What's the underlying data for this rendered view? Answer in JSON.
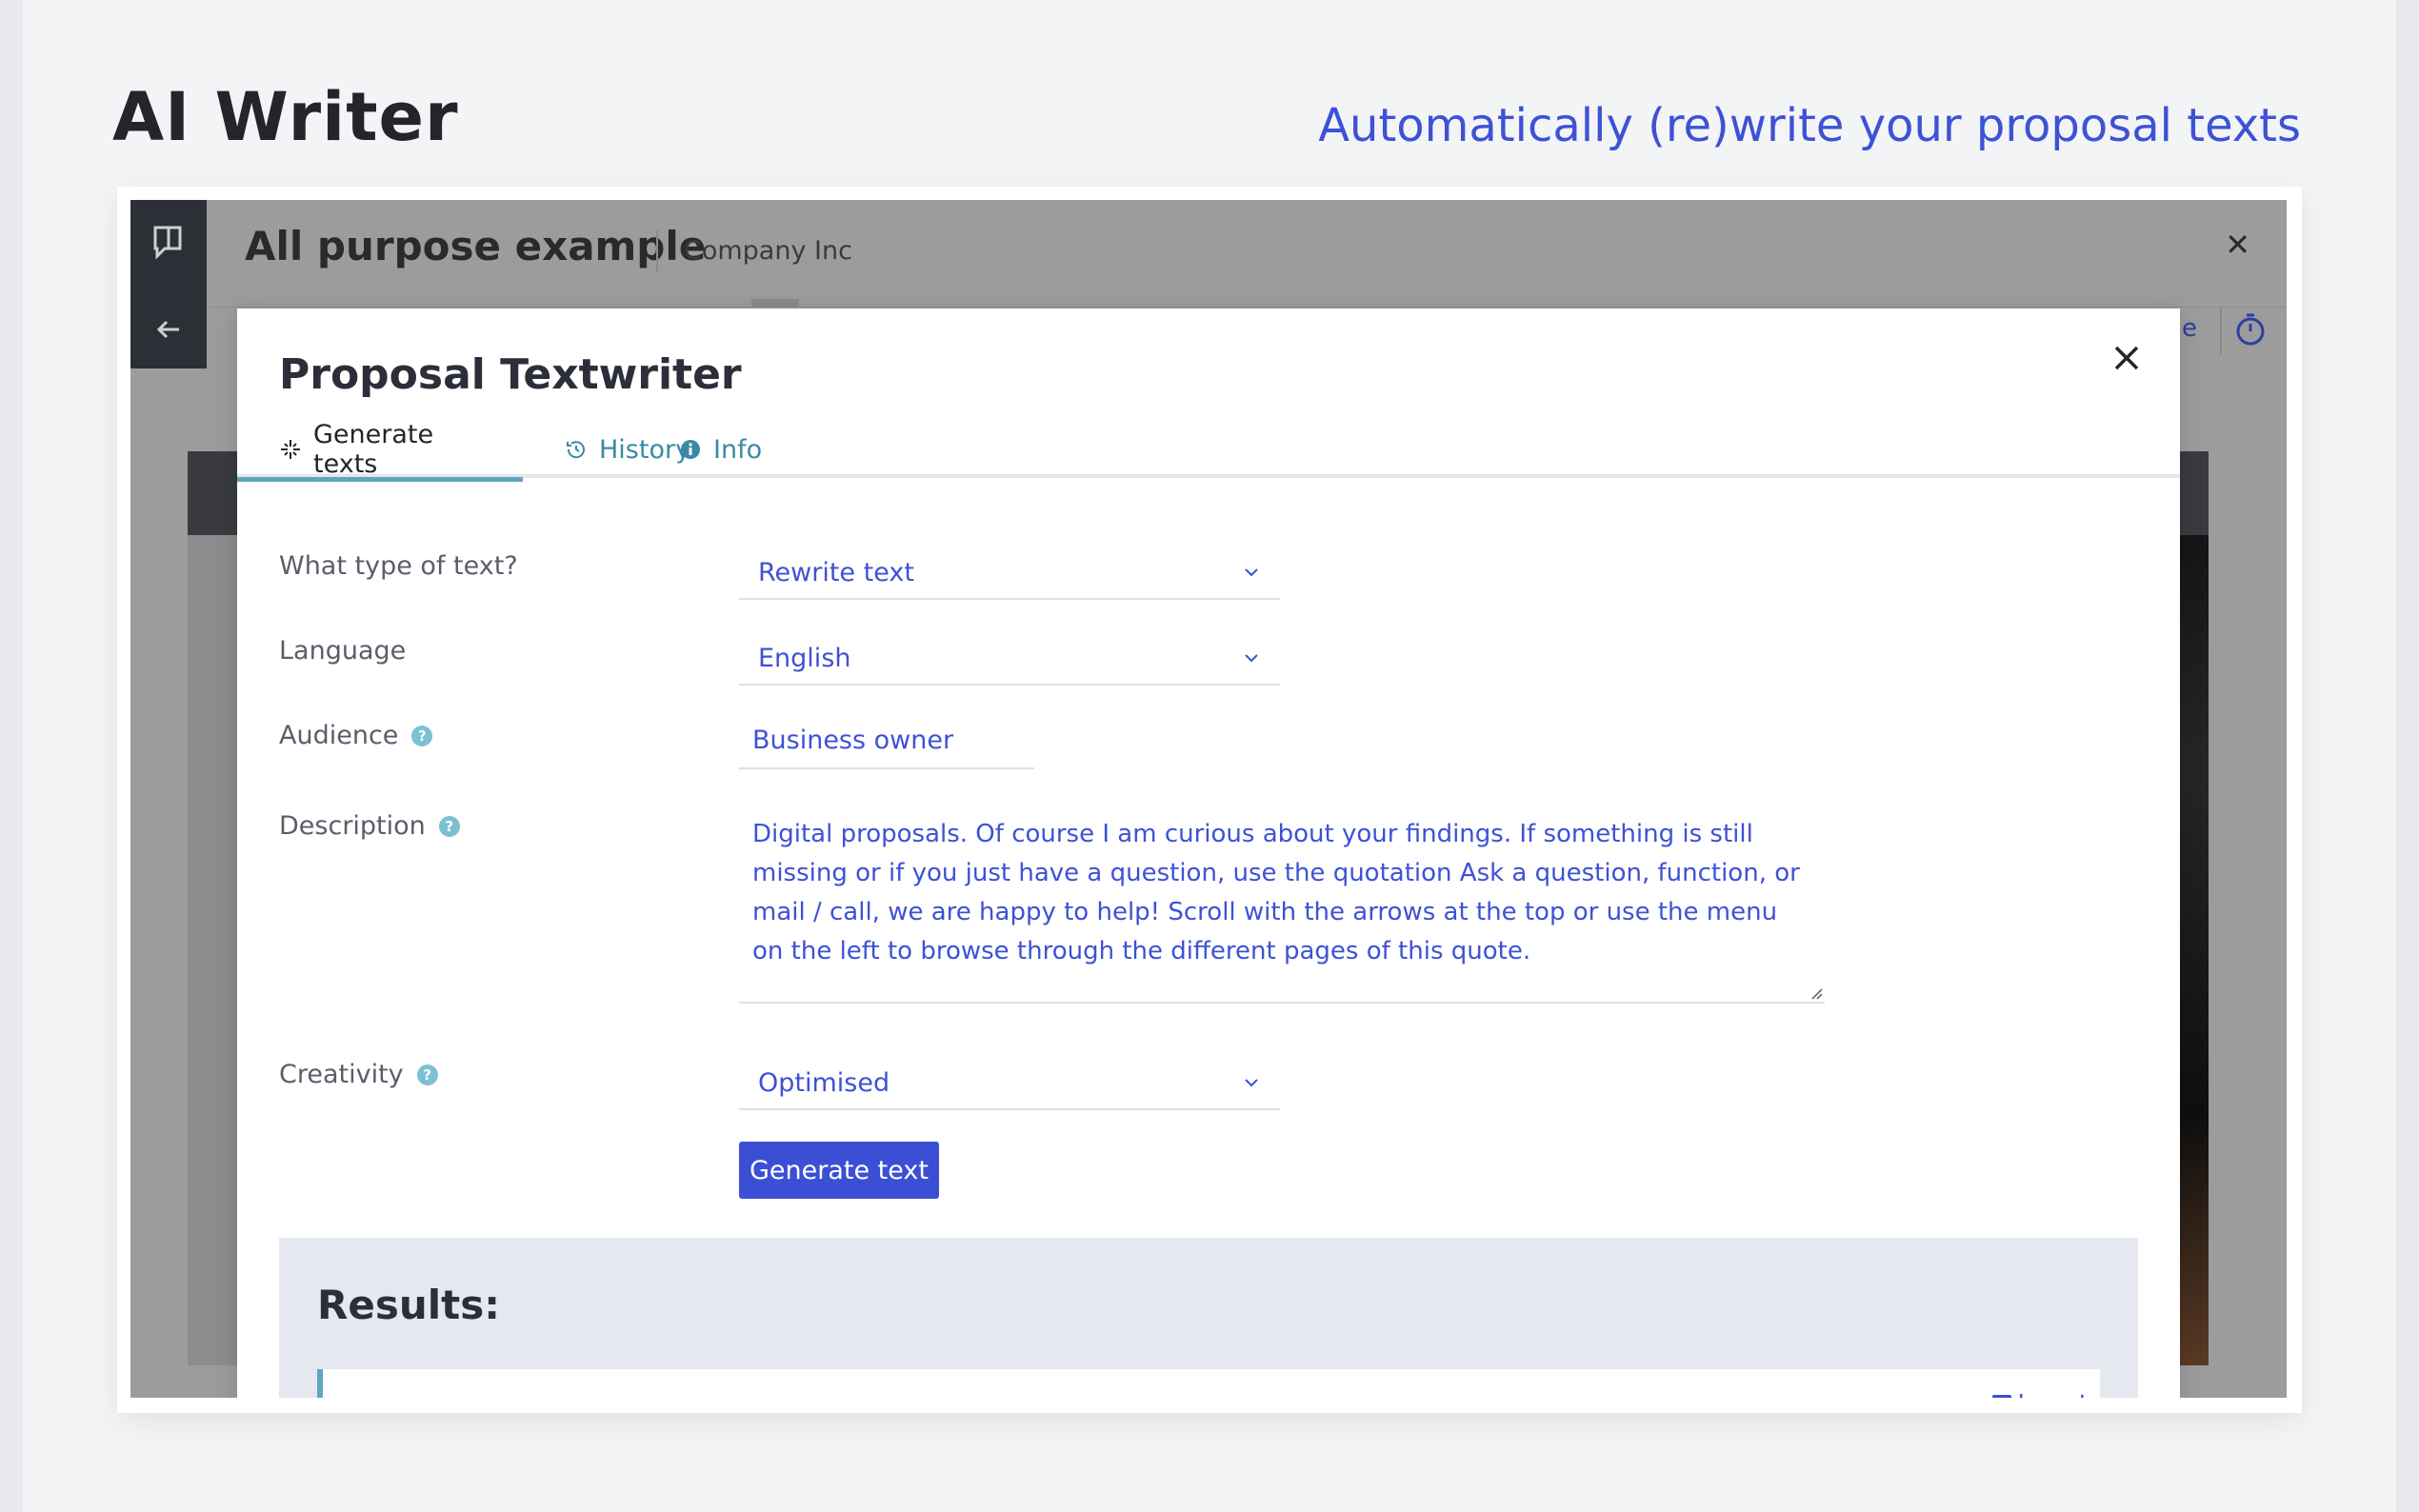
{
  "hero": {
    "title": "AI Writer",
    "subtitle": "Automatically (re)write your proposal texts"
  },
  "app": {
    "title": "All purpose example",
    "company": "Company Inc",
    "close_icon": "close-icon",
    "sidebar_icons": [
      "book-chat-icon",
      "arrow-left-icon"
    ],
    "right_link_partial": "e",
    "timer_icon": "stopwatch-icon"
  },
  "modal": {
    "title": "Proposal Textwriter",
    "close_icon": "close-icon",
    "tabs": [
      {
        "label": "Generate texts",
        "icon": "sparkle-icon",
        "active": true
      },
      {
        "label": "History",
        "icon": "history-icon",
        "active": false
      },
      {
        "label": "Info",
        "icon": "info-icon",
        "active": false
      }
    ],
    "form": {
      "text_type": {
        "label": "What type of text?",
        "value": "Rewrite text"
      },
      "language": {
        "label": "Language",
        "value": "English"
      },
      "audience": {
        "label": "Audience",
        "value": "Business owner",
        "help_icon": "question-icon"
      },
      "description": {
        "label": "Description",
        "help_icon": "question-icon",
        "value": "Digital proposals. Of course I am curious about your findings. If something is still missing or if you just have a question, use the quotation Ask a question, function, or mail / call, we are happy to help! Scroll with the arrows at the top or use the menu on the left to browse through the different pages of this quote."
      },
      "creativity": {
        "label": "Creativity",
        "value": "Optimised",
        "help_icon": "question-icon"
      },
      "generate_button": "Generate text"
    },
    "results": {
      "title": "Results:",
      "insert_label": "Insert"
    }
  },
  "colors": {
    "accent": "#3d52d5",
    "tab_underline": "#5fa7c0",
    "overlay": "#9c9c9c"
  }
}
